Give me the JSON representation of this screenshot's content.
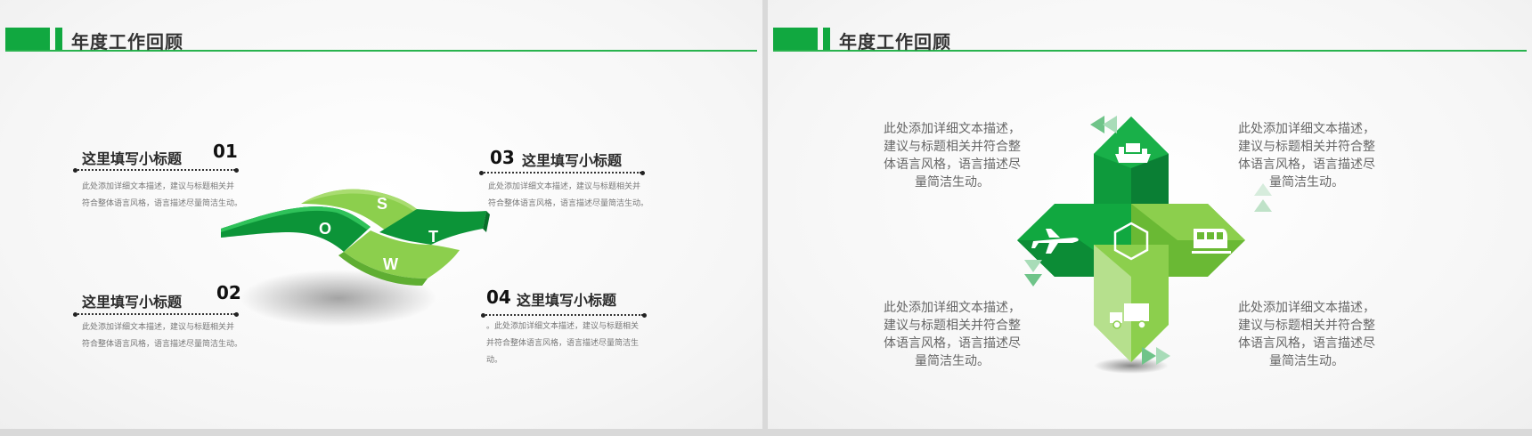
{
  "left_slide": {
    "header_title": "年度工作回顾",
    "items": [
      {
        "num": "01",
        "title": "这里填写小标题",
        "desc": [
          "此处添加详细文本描述，建议与标题相关并",
          "符合整体语言风格，语言描述尽量简洁生动。"
        ]
      },
      {
        "num": "02",
        "title": "这里填写小标题",
        "desc": [
          "此处添加详细文本描述，建议与标题相关并",
          "符合整体语言风格，语言描述尽量简洁生动。"
        ]
      },
      {
        "num": "03",
        "title": "这里填写小标题",
        "desc": [
          "此处添加详细文本描述，建议与标题相关并",
          "符合整体语言风格，语言描述尽量简洁生动。"
        ]
      },
      {
        "num": "04",
        "title": "这里填写小标题",
        "desc": [
          "。此处添加详细文本描述，建议与标题相关",
          "并符合整体语言风格，语言描述尽量简洁生",
          "动。"
        ]
      }
    ],
    "swot_letters": {
      "s": "S",
      "o": "O",
      "t": "T",
      "w": "W"
    }
  },
  "right_slide": {
    "header_title": "年度工作回顾",
    "descs": [
      [
        "此处添加详细文本描述，",
        "建议与标题相关并符合整",
        "体语言风格，语言描述尽",
        "量简洁生动。"
      ],
      [
        "此处添加详细文本描述，",
        "建议与标题相关并符合整",
        "体语言风格，语言描述尽",
        "量简洁生动。"
      ],
      [
        "此处添加详细文本描述，",
        "建议与标题相关并符合整",
        "体语言风格，语言描述尽",
        "量简洁生动。"
      ],
      [
        "此处添加详细文本描述，",
        "建议与标题相关并符合整",
        "体语言风格，语言描述尽",
        "量简洁生动。"
      ]
    ],
    "icons": [
      "ship-icon",
      "airplane-icon",
      "train-icon",
      "truck-icon",
      "hexagon-icon"
    ]
  },
  "colors": {
    "brand_green": "#11a840",
    "light_green": "#8ccf4d",
    "dark_green": "#0a7f34"
  }
}
